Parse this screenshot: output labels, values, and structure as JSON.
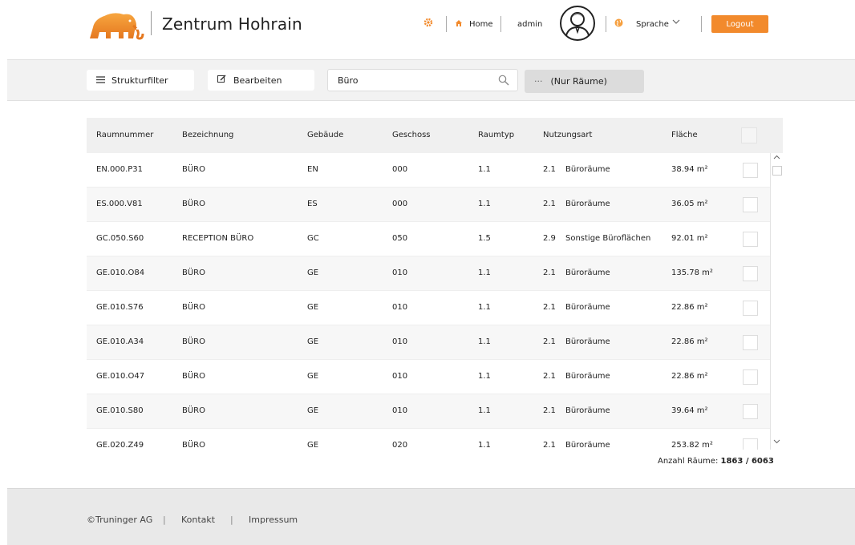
{
  "header": {
    "title": "Zentrum Hohrain",
    "home_label": "Home",
    "user": "admin",
    "language_label": "Sprache",
    "logout_label": "Logout"
  },
  "toolbar": {
    "filter_label": "Strukturfilter",
    "edit_label": "Bearbeiten",
    "search_value": "Büro",
    "filter_chip_dots": "···",
    "filter_chip_label": "(Nur Räume)"
  },
  "table": {
    "columns": [
      "Raumnummer",
      "Bezeichnung",
      "Gebäude",
      "Geschoss",
      "Raumtyp",
      "Nutzungsart",
      "Fläche"
    ],
    "rows": [
      {
        "nr": "EN.000.P31",
        "bez": "BÜRO",
        "geb": "EN",
        "gesch": "000",
        "typ": "1.1",
        "nut_code": "2.1",
        "nut": "Büroräume",
        "flaeche": "38.94 m²"
      },
      {
        "nr": "ES.000.V81",
        "bez": "BÜRO",
        "geb": "ES",
        "gesch": "000",
        "typ": "1.1",
        "nut_code": "2.1",
        "nut": "Büroräume",
        "flaeche": "36.05 m²"
      },
      {
        "nr": "GC.050.S60",
        "bez": "RECEPTION BÜRO",
        "geb": "GC",
        "gesch": "050",
        "typ": "1.5",
        "nut_code": "2.9",
        "nut": "Sonstige Büroflächen",
        "flaeche": "92.01 m²"
      },
      {
        "nr": "GE.010.O84",
        "bez": "BÜRO",
        "geb": "GE",
        "gesch": "010",
        "typ": "1.1",
        "nut_code": "2.1",
        "nut": "Büroräume",
        "flaeche": "135.78 m²"
      },
      {
        "nr": "GE.010.S76",
        "bez": "BÜRO",
        "geb": "GE",
        "gesch": "010",
        "typ": "1.1",
        "nut_code": "2.1",
        "nut": "Büroräume",
        "flaeche": "22.86 m²"
      },
      {
        "nr": "GE.010.A34",
        "bez": "BÜRO",
        "geb": "GE",
        "gesch": "010",
        "typ": "1.1",
        "nut_code": "2.1",
        "nut": "Büroräume",
        "flaeche": "22.86 m²"
      },
      {
        "nr": "GE.010.O47",
        "bez": "BÜRO",
        "geb": "GE",
        "gesch": "010",
        "typ": "1.1",
        "nut_code": "2.1",
        "nut": "Büroräume",
        "flaeche": "22.86 m²"
      },
      {
        "nr": "GE.010.S80",
        "bez": "BÜRO",
        "geb": "GE",
        "gesch": "010",
        "typ": "1.1",
        "nut_code": "2.1",
        "nut": "Büroräume",
        "flaeche": "39.64 m²"
      },
      {
        "nr": "GE.020.Z49",
        "bez": "BÜRO",
        "geb": "GE",
        "gesch": "020",
        "typ": "1.1",
        "nut_code": "2.1",
        "nut": "Büroräume",
        "flaeche": "253.82 m²"
      }
    ]
  },
  "count": {
    "label": "Anzahl Räume:",
    "value": "1863 / 6063"
  },
  "footer": {
    "copyright": "©Truninger AG",
    "sep": "|",
    "contact": "Kontakt",
    "impressum": "Impressum"
  },
  "colors": {
    "accent": "#f28a2c"
  }
}
